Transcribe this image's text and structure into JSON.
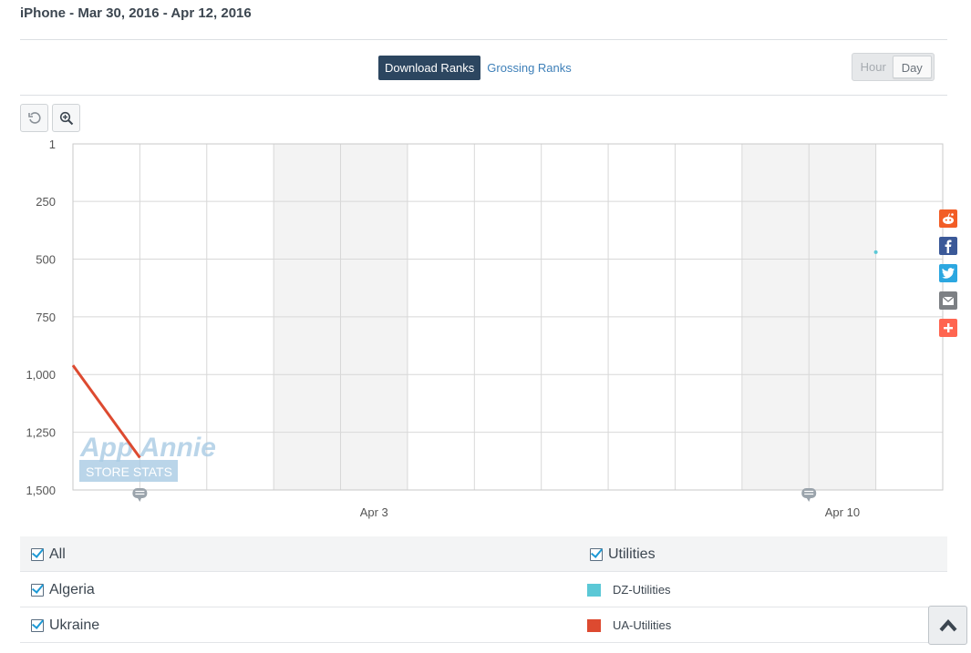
{
  "header": {
    "title": "iPhone - Mar 30, 2016 - Apr 12, 2016"
  },
  "rank_tabs": {
    "download": "Download Ranks",
    "grossing": "Grossing Ranks",
    "active": "download"
  },
  "time_toggle": {
    "hour": "Hour",
    "day": "Day",
    "active": "day"
  },
  "toolbar": {
    "reset_icon": "reset-zoom-icon",
    "zoom_icon": "zoom-in-icon"
  },
  "watermark": {
    "line1": "App Annie",
    "line2": "STORE STATS"
  },
  "share_icons": [
    "reddit-icon",
    "facebook-icon",
    "twitter-icon",
    "email-icon",
    "more-share-icon"
  ],
  "colors": {
    "dz": "#5bc8d6",
    "ua": "#dd4a30",
    "weekend": "#f3f3f3",
    "grid": "#d8d8d8",
    "tab_active": "#2c4660"
  },
  "chart_data": {
    "type": "line",
    "y_reversed": true,
    "ylim": [
      1,
      1500
    ],
    "yticks": [
      "1",
      "250",
      "500",
      "750",
      "1,000",
      "1,250",
      "1,500"
    ],
    "ytick_values": [
      1,
      250,
      500,
      750,
      1000,
      1250,
      1500
    ],
    "x_dates": [
      "2016-03-30",
      "2016-03-31",
      "2016-04-01",
      "2016-04-02",
      "2016-04-03",
      "2016-04-04",
      "2016-04-05",
      "2016-04-06",
      "2016-04-07",
      "2016-04-08",
      "2016-04-09",
      "2016-04-10",
      "2016-04-11",
      "2016-04-12"
    ],
    "xticks": [
      {
        "date": "2016-04-03",
        "label": "Apr 3"
      },
      {
        "date": "2016-04-10",
        "label": "Apr 10"
      }
    ],
    "weekend_dates": [
      "2016-04-02",
      "2016-04-03",
      "2016-04-09",
      "2016-04-10"
    ],
    "annotation_dates": [
      "2016-03-31",
      "2016-04-10"
    ],
    "series": [
      {
        "name": "DZ-Utilities",
        "color": "#5bc8d6",
        "points": [
          {
            "date": "2016-04-11",
            "rank": 470
          }
        ]
      },
      {
        "name": "UA-Utilities",
        "color": "#dd4a30",
        "points": [
          {
            "date": "2016-03-30",
            "rank": 960
          },
          {
            "date": "2016-03-31",
            "rank": 1360
          }
        ]
      }
    ],
    "grid": true
  },
  "legend": {
    "all": "All",
    "category": "Utilities",
    "rows": [
      {
        "country": "Algeria",
        "series": "DZ-Utilities",
        "color": "#5bc8d6"
      },
      {
        "country": "Ukraine",
        "series": "UA-Utilities",
        "color": "#dd4a30"
      }
    ]
  },
  "scroll_top": {
    "icon": "chevron-up-icon"
  }
}
